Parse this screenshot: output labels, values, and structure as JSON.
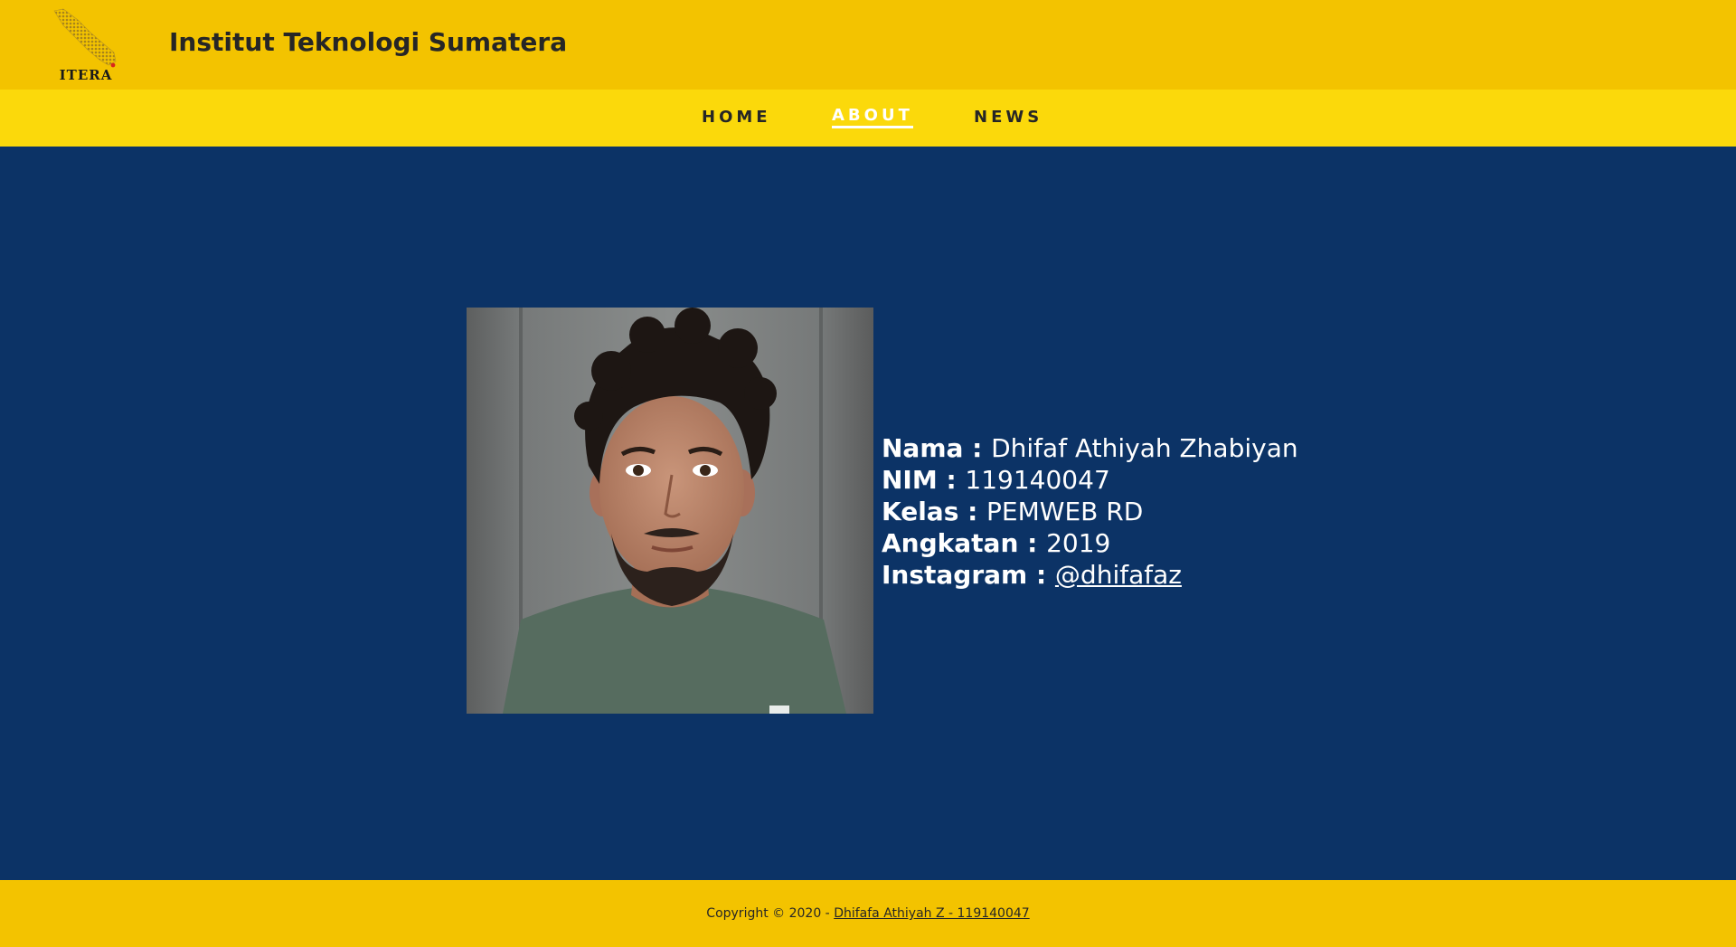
{
  "header": {
    "logo_text": "ITERA",
    "title": "Institut Teknologi Sumatera"
  },
  "nav": {
    "items": [
      {
        "label": "HOME",
        "active": false
      },
      {
        "label": "ABOUT",
        "active": true
      },
      {
        "label": "NEWS",
        "active": false
      }
    ]
  },
  "profile": {
    "photo_icon": "profile-photo",
    "fields": [
      {
        "label": "Nama :",
        "value": "Dhifaf Athiyah Zhabiyan"
      },
      {
        "label": "NIM :",
        "value": "119140047"
      },
      {
        "label": "Kelas :",
        "value": "PEMWEB RD"
      },
      {
        "label": "Angkatan :",
        "value": "2019"
      },
      {
        "label": "Instagram :",
        "value": "@dhifafaz"
      }
    ]
  },
  "footer": {
    "copyright": "Copyright © 2020 - ",
    "author_link": "Dhifafa Athiyah Z - 119140047"
  },
  "colors": {
    "header_bg": "#f3c300",
    "nav_bg": "#fbd90b",
    "main_bg": "#0c3366",
    "footer_bg": "#f3c300"
  }
}
